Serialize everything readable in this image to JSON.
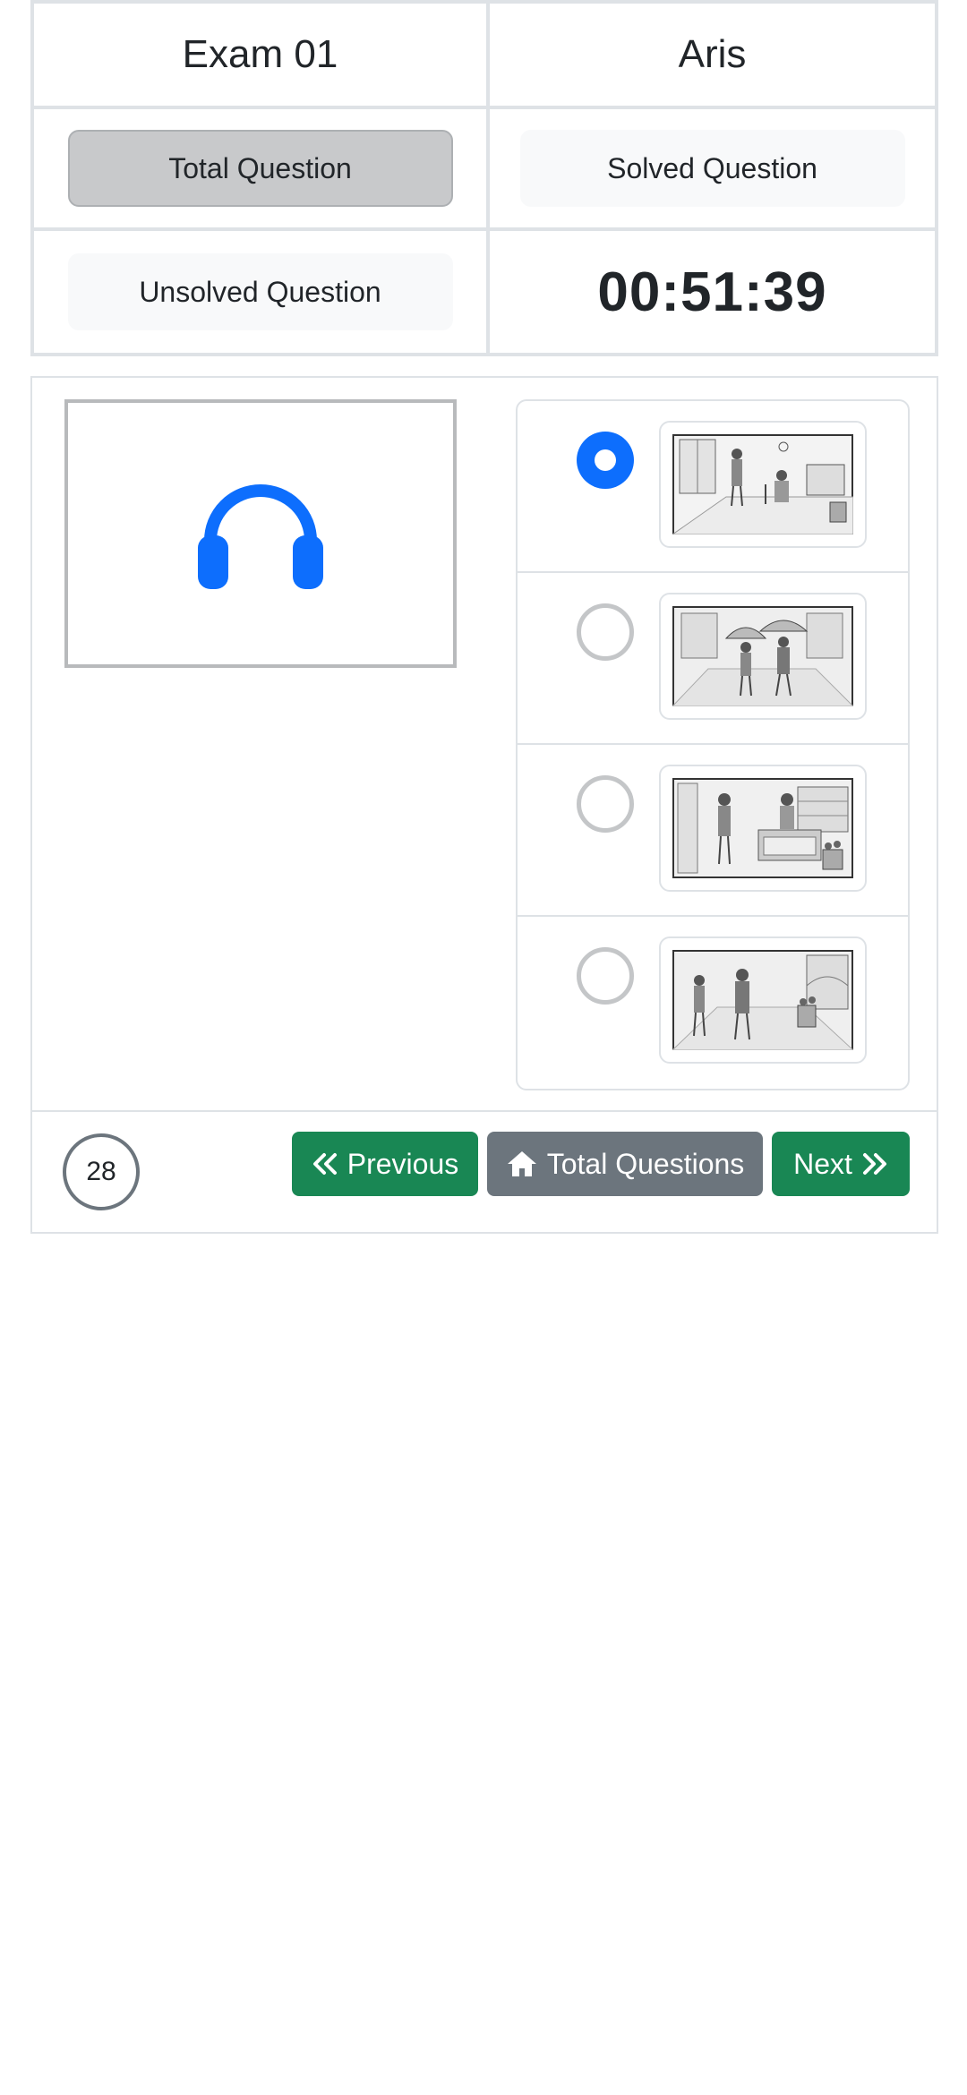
{
  "header": {
    "exam_title": "Exam 01",
    "user_name": "Aris",
    "total_question_label": "Total Question",
    "solved_question_label": "Solved Question",
    "unsolved_question_label": "Unsolved Question",
    "timer": "00:51:39"
  },
  "question": {
    "number": "28",
    "audio_icon": "headphones-icon",
    "options": [
      {
        "selected": true,
        "image": "office-scene-picture"
      },
      {
        "selected": false,
        "image": "umbrella-walk-picture"
      },
      {
        "selected": false,
        "image": "shop-counter-picture"
      },
      {
        "selected": false,
        "image": "street-scene-picture"
      }
    ]
  },
  "footer": {
    "previous_label": "Previous",
    "total_questions_label": "Total Questions",
    "next_label": "Next"
  },
  "colors": {
    "primary": "#0d6efd",
    "success": "#198754",
    "secondary": "#6c757d",
    "border": "#dee2e6"
  }
}
